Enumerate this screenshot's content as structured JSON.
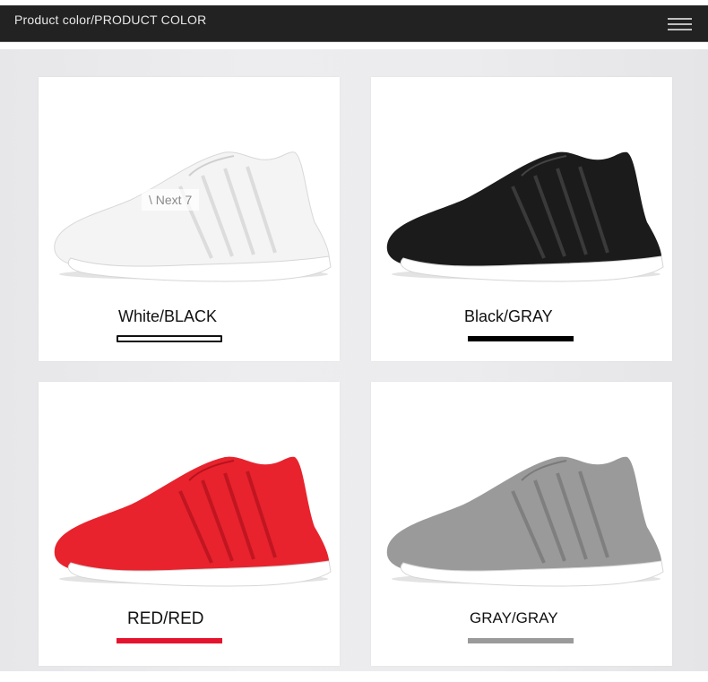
{
  "header": {
    "title": "Product color/PRODUCT COLOR",
    "menu_icon": "hamburger-menu-icon"
  },
  "overlay": {
    "next_label": "\\ Next 7"
  },
  "colors": [
    {
      "label": "White/BLACK",
      "upper_color": "#f4f4f4",
      "swatch_fill": "#ffffff",
      "swatch_border": "#111111"
    },
    {
      "label": "Black/GRAY",
      "upper_color": "#1b1b1b",
      "swatch_fill": "#000000",
      "swatch_border": "#000000"
    },
    {
      "label": "RED/RED",
      "upper_color": "#e8232d",
      "swatch_fill": "#e5142e",
      "swatch_border": "#e5142e"
    },
    {
      "label": "GRAY/GRAY",
      "upper_color": "#9a9a9a",
      "swatch_fill": "#9a9a9a",
      "swatch_border": "#9a9a9a"
    }
  ]
}
